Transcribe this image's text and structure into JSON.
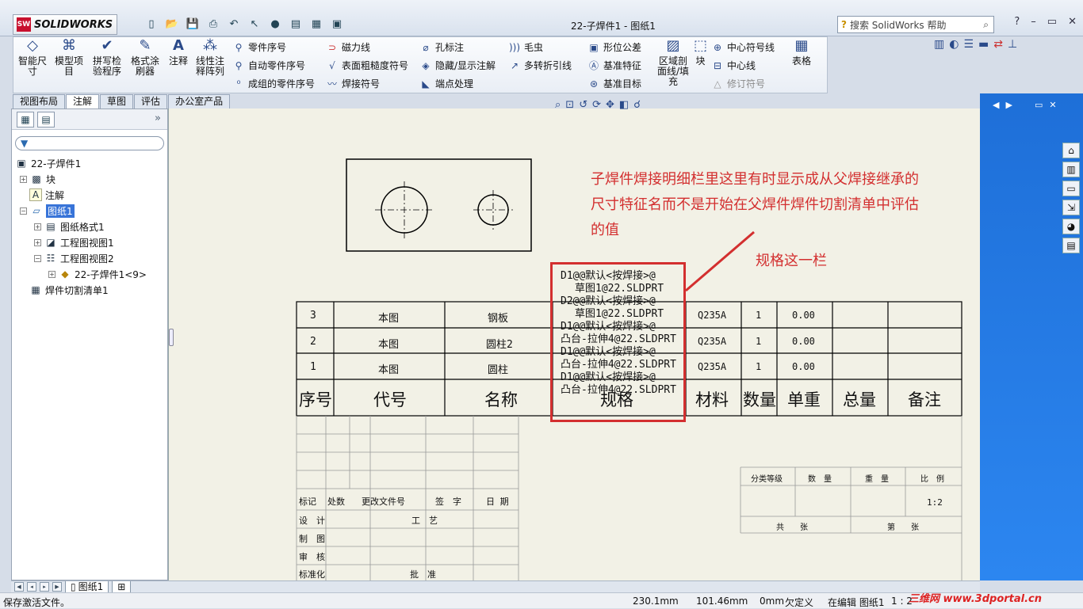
{
  "app": {
    "brand": "SOLIDWORKS",
    "sw_mark": "SW",
    "doc_title": "22-子焊件1 - 图纸1",
    "help_placeholder": "搜索 SolidWorks 帮助",
    "help_icon": "?"
  },
  "ribbon": {
    "smart_dim": "智能尺\n寸",
    "model_items": "模型项\n目",
    "spell_check": "拼写检\n验程序",
    "format_painter": "格式涂\n刷器",
    "note": "注释",
    "linear_pattern": "线性注\n释阵列",
    "balloon": "零件序号",
    "auto_balloon": "自动零件序号",
    "stacked_balloon": "成组的零件序号",
    "magnetic_line": "磁力线",
    "surface_finish": "表面粗糙度符号",
    "weld_symbol": "焊接符号",
    "hole_callout": "孔标注",
    "hide_show": "隐藏/显示注解",
    "end_treatment": "端点处理",
    "cosmetic_thread": "毛虫",
    "multi_jog": "多转折引线",
    "gtol": "形位公差",
    "datum_feature": "基准特征",
    "datum_target": "基准目标",
    "area_hatch": "区域剖\n面线/填\n充",
    "block": "块",
    "center_mark": "中心符号线",
    "centerline": "中心线",
    "revision_symbol": "修订符号",
    "table": "表格"
  },
  "tabs": [
    "视图布局",
    "注解",
    "草图",
    "评估",
    "办公室产品"
  ],
  "tree": {
    "root": "22-子焊件1",
    "block": "块",
    "annotations": "注解",
    "sheet": "图纸1",
    "sheet_format": "图纸格式1",
    "drawing_view1": "工程图视图1",
    "drawing_view2": "工程图视图2",
    "part_ref": "22-子焊件1<9>",
    "cut_list": "焊件切割清单1"
  },
  "drawing": {
    "bom_rows": [
      {
        "no": "3",
        "code": "本图",
        "name": "钢板",
        "material": "Q235A",
        "qty": "1",
        "unit_weight": "0.00"
      },
      {
        "no": "2",
        "code": "本图",
        "name": "圆柱2",
        "material": "Q235A",
        "qty": "1",
        "unit_weight": "0.00"
      },
      {
        "no": "1",
        "code": "本图",
        "name": "圆柱",
        "material": "Q235A",
        "qty": "1",
        "unit_weight": "0.00"
      }
    ],
    "bom_header": [
      "序号",
      "代号",
      "名称",
      "规格",
      "材料",
      "数量",
      "单重",
      "总量",
      "备注"
    ],
    "spec_overflow": [
      "D1@@默认<按焊接>@",
      "草图1@22.SLDPRT",
      "D2@@默认<按焊接>@",
      "草图1@22.SLDPRT",
      "D1@@默认<按焊接>@",
      "凸台-拉伸4@22.SLDPRT",
      "D1@@默认<按焊接>@",
      "凸台-拉伸4@22.SLDPRT",
      "D1@@默认<按焊接>@",
      "凸台-拉伸4@22.SLDPRT"
    ],
    "title_block": {
      "mark": "标记",
      "count": "处数",
      "change_doc": "更改文件号",
      "sign": "签　字",
      "date": "日 期",
      "design": "设　计",
      "process": "工　艺",
      "draw": "制　图",
      "check": "审　核",
      "standard": "标准化",
      "approve": "批　准",
      "class": "分类等级",
      "quantity": "数　量",
      "weight": "重　量",
      "scale": "比　例",
      "scale_value": "1:2",
      "total": "共　　张",
      "sheet_no": "第　　张"
    }
  },
  "annotation": {
    "callout": "子焊件焊接明细栏里这里有时显示成从父焊接继承的尺寸特征名而不是开始在父焊件焊件切割清单中评估的值",
    "label": "规格这一栏",
    "color": "#d32f2f"
  },
  "sheet_tab": "图纸1",
  "status": {
    "message": "保存激活文件。",
    "x": "230.1mm",
    "y": "101.46mm",
    "z": "0mm",
    "constraint": "欠定义",
    "editing": "在编辑 图纸1",
    "scale": "1 : 2"
  },
  "watermark": "三维网 www.3dportal.cn"
}
